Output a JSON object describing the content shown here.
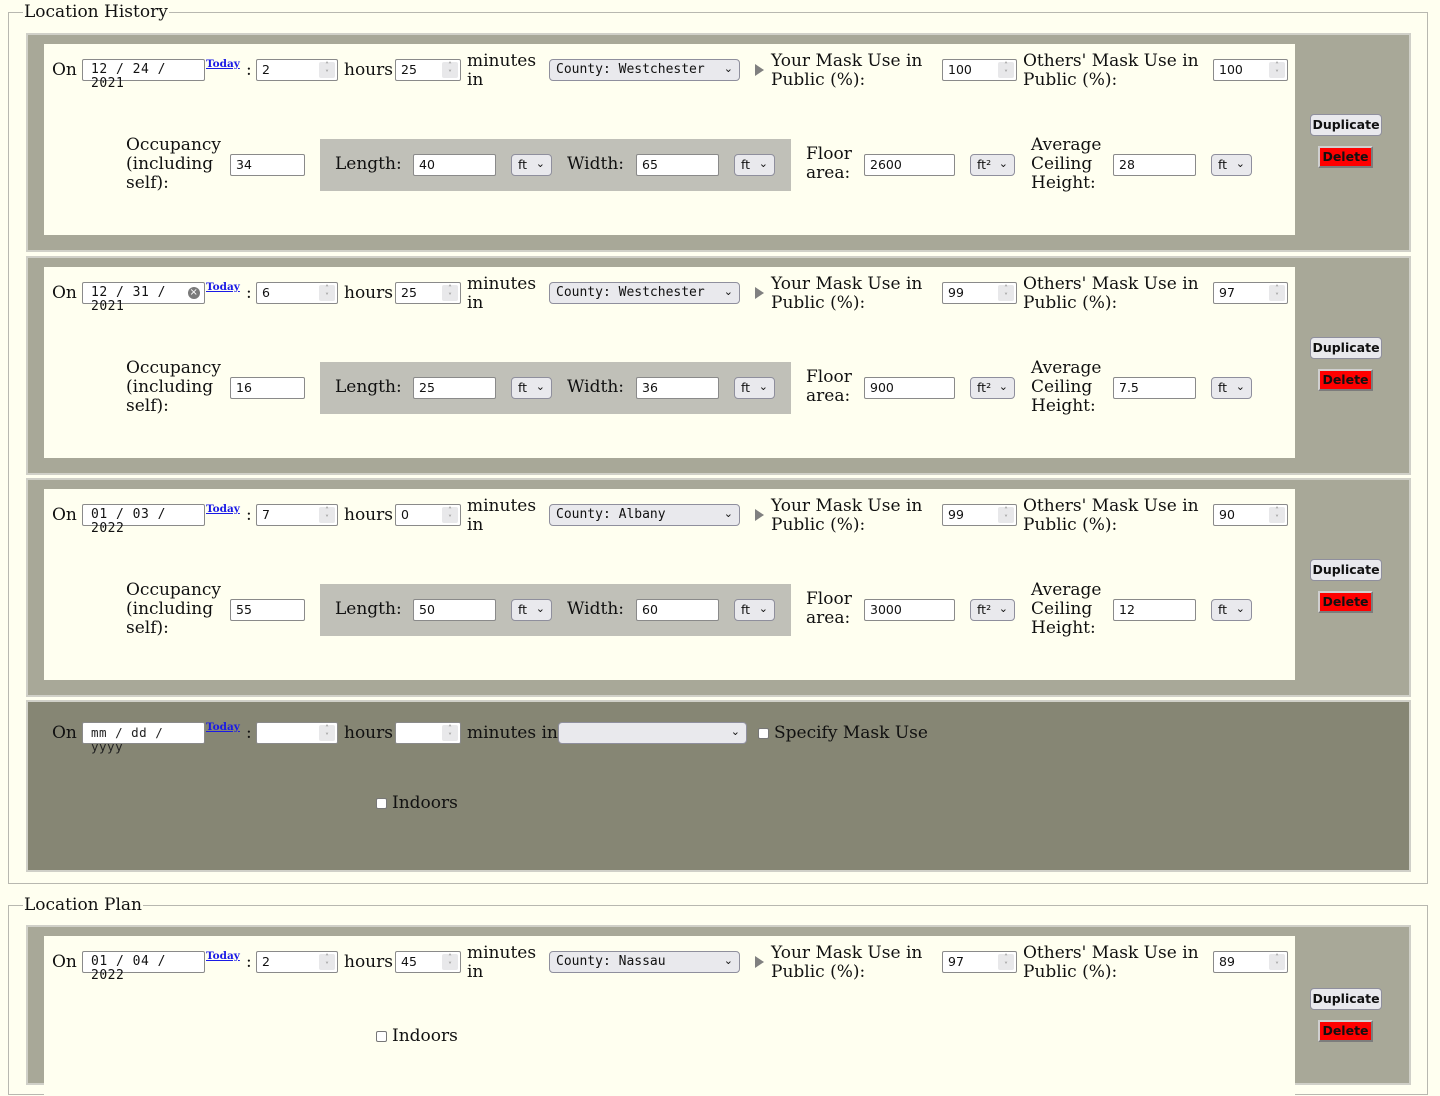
{
  "history_section": {
    "legend": "Location History"
  },
  "plan_section": {
    "legend": "Location Plan"
  },
  "labels": {
    "on": "On",
    "today": "Today",
    "colon": ":",
    "hours": "hours",
    "minutes_in_1": "minutes",
    "minutes_in_2": "in",
    "minutes_in_inline": "minutes in",
    "your_mask_1": "Your Mask Use in",
    "your_mask_2": "Public (%):",
    "others_mask_1": "Others' Mask Use in",
    "others_mask_2": "Public (%):",
    "occupancy_1": "Occupancy",
    "occupancy_2": "(including",
    "occupancy_3": "self):",
    "length": "Length:",
    "width": "Width:",
    "floor_1": "Floor",
    "floor_2": "area:",
    "ceiling_1": "Average",
    "ceiling_2": "Ceiling",
    "ceiling_3": "Height:",
    "specify_mask": "Specify Mask Use",
    "indoors": "Indoors",
    "duplicate": "Duplicate",
    "delete": "Delete",
    "date_placeholder": "mm / dd / yyyy"
  },
  "history": [
    {
      "date": "12 / 24 / 2021",
      "hours": "2",
      "minutes": "25",
      "location": "County: Westchester",
      "your_mask": "100",
      "others_mask": "100",
      "occupancy": "34",
      "length": "40",
      "length_unit": "ft",
      "width": "65",
      "width_unit": "ft",
      "floor_area": "2600",
      "floor_unit": "ft²",
      "ceiling": "28",
      "ceiling_unit": "ft"
    },
    {
      "date": "12 / 31 / 2021",
      "hours": "6",
      "minutes": "25",
      "location": "County: Westchester",
      "your_mask": "99",
      "others_mask": "97",
      "occupancy": "16",
      "length": "25",
      "length_unit": "ft",
      "width": "36",
      "width_unit": "ft",
      "floor_area": "900",
      "floor_unit": "ft²",
      "ceiling": "7.5",
      "ceiling_unit": "ft"
    },
    {
      "date": "01 / 03 / 2022",
      "hours": "7",
      "minutes": "0",
      "location": "County: Albany",
      "your_mask": "99",
      "others_mask": "90",
      "occupancy": "55",
      "length": "50",
      "length_unit": "ft",
      "width": "60",
      "width_unit": "ft",
      "floor_area": "3000",
      "floor_unit": "ft²",
      "ceiling": "12",
      "ceiling_unit": "ft"
    }
  ],
  "new_entry": {
    "date": "",
    "hours": "",
    "minutes": "",
    "location": "",
    "specify_mask_checked": false,
    "indoors_checked": false
  },
  "plan": [
    {
      "date": "01 / 04 / 2022",
      "hours": "2",
      "minutes": "45",
      "location": "County: Nassau",
      "your_mask": "97",
      "others_mask": "89",
      "indoors_checked": false
    }
  ]
}
